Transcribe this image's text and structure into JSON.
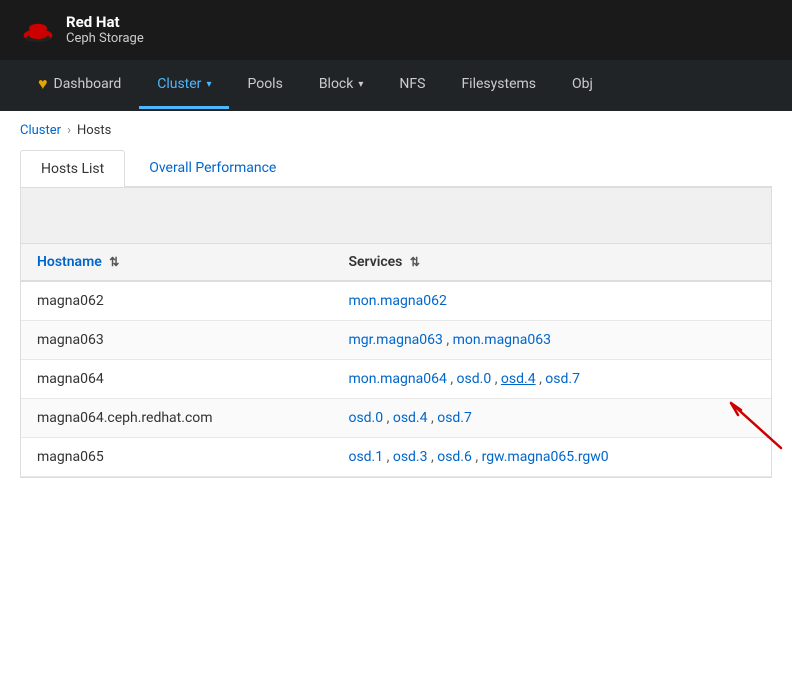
{
  "header": {
    "brand": "Red Hat",
    "sub": "Ceph Storage"
  },
  "nav": {
    "items": [
      {
        "label": "Dashboard",
        "id": "dashboard",
        "active": false,
        "hasDropdown": false,
        "hasIcon": true
      },
      {
        "label": "Cluster",
        "id": "cluster",
        "active": true,
        "hasDropdown": true,
        "hasIcon": false
      },
      {
        "label": "Pools",
        "id": "pools",
        "active": false,
        "hasDropdown": false,
        "hasIcon": false
      },
      {
        "label": "Block",
        "id": "block",
        "active": false,
        "hasDropdown": true,
        "hasIcon": false
      },
      {
        "label": "NFS",
        "id": "nfs",
        "active": false,
        "hasDropdown": false,
        "hasIcon": false
      },
      {
        "label": "Filesystems",
        "id": "filesystems",
        "active": false,
        "hasDropdown": false,
        "hasIcon": false
      },
      {
        "label": "Obj",
        "id": "obj",
        "active": false,
        "hasDropdown": false,
        "hasIcon": false
      }
    ]
  },
  "breadcrumb": {
    "parent": "Cluster",
    "current": "Hosts",
    "separator": "›"
  },
  "tabs": [
    {
      "label": "Hosts List",
      "active": true
    },
    {
      "label": "Overall Performance",
      "active": false
    }
  ],
  "table": {
    "columns": [
      {
        "label": "Hostname",
        "id": "hostname",
        "sortable": true,
        "sortIcon": "⇅"
      },
      {
        "label": "Services",
        "id": "services",
        "sortable": true,
        "sortIcon": "⇅"
      }
    ],
    "rows": [
      {
        "hostname": "magna062",
        "services": [
          {
            "label": "mon.magna062",
            "underlined": false
          }
        ]
      },
      {
        "hostname": "magna063",
        "services": [
          {
            "label": "mgr.magna063",
            "underlined": false
          },
          {
            "label": "mon.magna063",
            "underlined": false
          }
        ]
      },
      {
        "hostname": "magna064",
        "services": [
          {
            "label": "mon.magna064",
            "underlined": false
          },
          {
            "label": "osd.0",
            "underlined": false
          },
          {
            "label": "osd.4",
            "underlined": true,
            "hasArrow": true
          },
          {
            "label": "osd.7",
            "underlined": false
          }
        ]
      },
      {
        "hostname": "magna064.ceph.redhat.com",
        "services": [
          {
            "label": "osd.0",
            "underlined": false
          },
          {
            "label": "osd.4",
            "underlined": false
          },
          {
            "label": "osd.7",
            "underlined": false
          }
        ]
      },
      {
        "hostname": "magna065",
        "services": [
          {
            "label": "osd.1",
            "underlined": false
          },
          {
            "label": "osd.3",
            "underlined": false
          },
          {
            "label": "osd.6",
            "underlined": false
          },
          {
            "label": "rgw.magna065.rgw0",
            "underlined": false
          }
        ]
      }
    ]
  }
}
